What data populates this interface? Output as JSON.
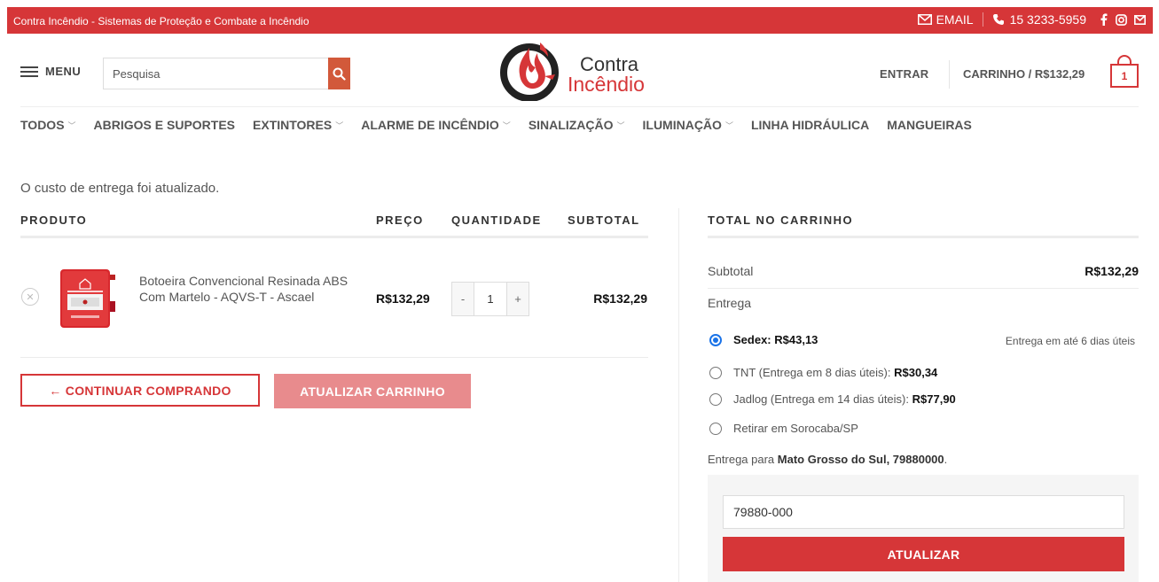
{
  "topbar": {
    "site_title": "Contra Incêndio - Sistemas de Proteção e Combate a Incêndio",
    "email_label": "EMAIL",
    "phone": "15 3233-5959",
    "bg_color": "#d63638"
  },
  "header": {
    "menu_label": "MENU",
    "search_placeholder": "Pesquisa",
    "logo_line1": "Contra",
    "logo_line2": "Incêndio",
    "login_label": "ENTRAR",
    "cart_label": "CARRINHO / R$132,29",
    "cart_count": "1"
  },
  "nav": {
    "items": [
      {
        "label": "TODOS",
        "dropdown": true
      },
      {
        "label": "ABRIGOS E SUPORTES",
        "dropdown": false
      },
      {
        "label": "EXTINTORES",
        "dropdown": true
      },
      {
        "label": "ALARME DE INCÊNDIO",
        "dropdown": true
      },
      {
        "label": "SINALIZAÇÃO",
        "dropdown": true
      },
      {
        "label": "ILUMINAÇÃO",
        "dropdown": true
      },
      {
        "label": "LINHA HIDRÁULICA",
        "dropdown": false
      },
      {
        "label": "MANGUEIRAS",
        "dropdown": false
      }
    ]
  },
  "cart": {
    "notice": "O custo de entrega foi atualizado.",
    "headers": {
      "product": "PRODUTO",
      "price": "PREÇO",
      "quantity": "QUANTIDADE",
      "subtotal": "SUBTOTAL"
    },
    "items": [
      {
        "name": "Botoeira Convencional Resinada ABS Com Martelo - AQVS-T - Ascael",
        "price": "R$132,29",
        "quantity": "1",
        "subtotal": "R$132,29"
      }
    ],
    "continue_label": "← CONTINUAR COMPRANDO",
    "update_label": "ATUALIZAR CARRINHO"
  },
  "totals": {
    "title": "TOTAL NO CARRINHO",
    "subtotal_label": "Subtotal",
    "subtotal_value": "R$132,29",
    "shipping_label": "Entrega",
    "options": [
      {
        "label": "Sedex:",
        "price": "R$43,13",
        "selected": true,
        "note": "Entrega em até 6 dias úteis"
      },
      {
        "label": "TNT (Entrega em 8 dias úteis):",
        "price": "R$30,34",
        "selected": false
      },
      {
        "label": "Jadlog (Entrega em 14 dias úteis):",
        "price": "R$77,90",
        "selected": false
      },
      {
        "label": "Retirar em Sorocaba/SP",
        "price": "",
        "selected": false
      }
    ],
    "ship_to_prefix": "Entrega para",
    "ship_to_location": "Mato Grosso do Sul, 79880000",
    "ship_to_suffix": ".",
    "postcode_value": "79880-000",
    "calc_button": "ATUALIZAR"
  },
  "colors": {
    "accent": "#d63638",
    "search_button": "#d2593a",
    "update_disabled": "#e88b8d",
    "radio_selected": "#1a73e8"
  }
}
